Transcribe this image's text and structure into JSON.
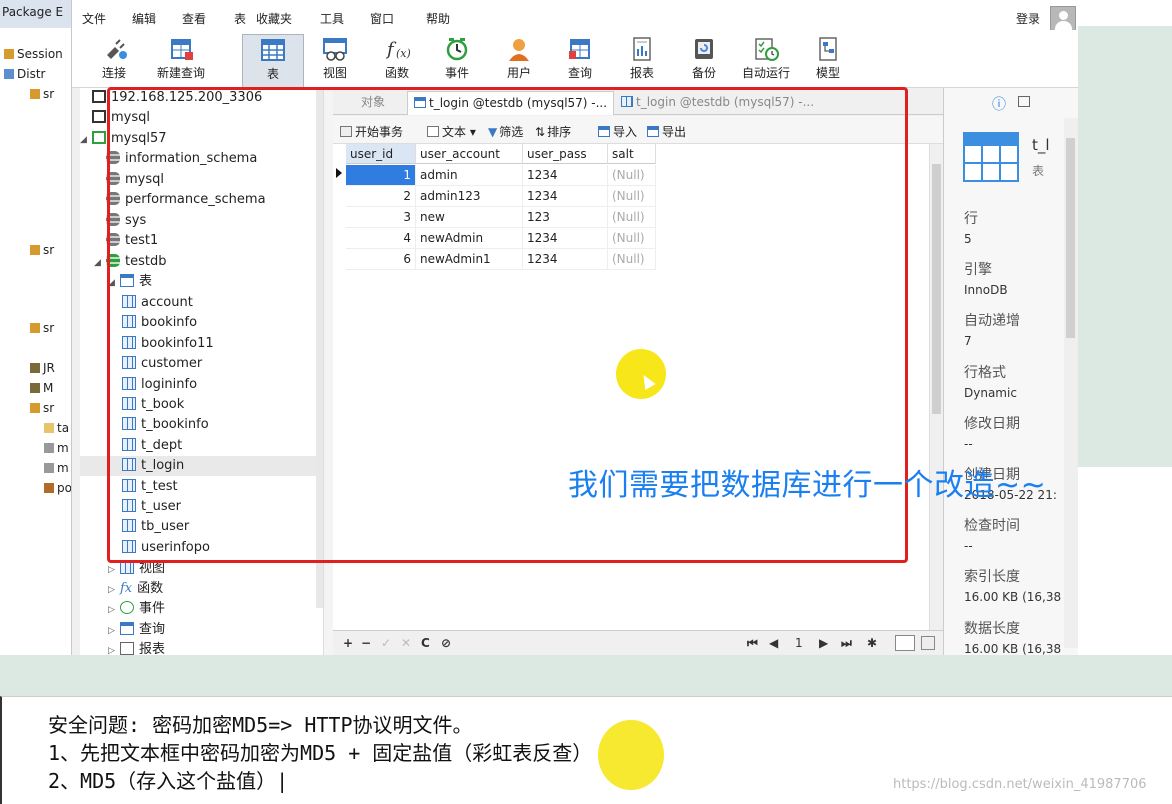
{
  "eclipse": {
    "header": "Package E",
    "items": [
      "Session",
      "Distr",
      "sr",
      "sr",
      "sr",
      "JR",
      "M",
      "sr",
      "ta",
      "m",
      "m",
      "po"
    ]
  },
  "menubar": {
    "items": [
      "文件",
      "编辑",
      "查看",
      "表",
      "收藏夹",
      "工具",
      "窗口",
      "帮助"
    ],
    "login": "登录"
  },
  "toolbar": {
    "buttons": [
      {
        "label": "连接",
        "icon": "plug-icon"
      },
      {
        "label": "新建查询",
        "icon": "new-query-icon"
      },
      {
        "label": "表",
        "icon": "table-icon",
        "active": true
      },
      {
        "label": "视图",
        "icon": "view-icon"
      },
      {
        "label": "函数",
        "icon": "function-icon"
      },
      {
        "label": "事件",
        "icon": "clock-icon"
      },
      {
        "label": "用户",
        "icon": "user-icon"
      },
      {
        "label": "查询",
        "icon": "query-icon"
      },
      {
        "label": "报表",
        "icon": "report-icon"
      },
      {
        "label": "备份",
        "icon": "backup-icon"
      },
      {
        "label": "自动运行",
        "icon": "autorun-icon"
      },
      {
        "label": "模型",
        "icon": "model-icon"
      }
    ]
  },
  "tree": {
    "connection": "192.168.125.200_3306",
    "conn_mysql": "mysql",
    "conn_mysql57": "mysql57",
    "databases": [
      "information_schema",
      "mysql",
      "performance_schema",
      "sys",
      "test1",
      "testdb"
    ],
    "tables_label": "表",
    "tables": [
      "account",
      "bookinfo",
      "bookinfo11",
      "customer",
      "logininfo",
      "t_book",
      "t_bookinfo",
      "t_dept",
      "t_login",
      "t_test",
      "t_user",
      "tb_user",
      "userinfopo"
    ],
    "selected_table": "t_login",
    "views": "视图",
    "functions": "函数",
    "events": "事件",
    "queries": "查询",
    "reports": "报表",
    "fx": "fx"
  },
  "tabs": {
    "objects": "对象",
    "tab1": "t_login @testdb (mysql57) -...",
    "tab2": "t_login @testdb (mysql57) -..."
  },
  "subtoolbar": {
    "begin_tx": "开始事务",
    "text": "文本",
    "filter": "筛选",
    "sort": "排序",
    "import": "导入",
    "export": "导出"
  },
  "grid": {
    "columns": [
      "user_id",
      "user_account",
      "user_pass",
      "salt"
    ],
    "rows": [
      [
        "1",
        "admin",
        "1234",
        "(Null)"
      ],
      [
        "2",
        "admin123",
        "1234",
        "(Null)"
      ],
      [
        "3",
        "new",
        "123",
        "(Null)"
      ],
      [
        "4",
        "newAdmin",
        "1234",
        "(Null)"
      ],
      [
        "6",
        "newAdmin1",
        "1234",
        "(Null)"
      ]
    ]
  },
  "bottombar": {
    "add": "+",
    "remove": "−",
    "apply": "✓",
    "cancel": "✕",
    "refresh": "C",
    "stop": "⊘",
    "first": "⏮",
    "prev": "◀",
    "page": "1",
    "next": "▶",
    "last": "⏭",
    "settings": "✱"
  },
  "info": {
    "title": "t_l",
    "type": "表",
    "fields": [
      {
        "label": "行",
        "value": "5"
      },
      {
        "label": "引擎",
        "value": "InnoDB"
      },
      {
        "label": "自动递增",
        "value": "7"
      },
      {
        "label": "行格式",
        "value": "Dynamic"
      },
      {
        "label": "修改日期",
        "value": "--"
      },
      {
        "label": "创建日期",
        "value": "2018-05-22 21:"
      },
      {
        "label": "检查时间",
        "value": "--"
      },
      {
        "label": "索引长度",
        "value": "16.00 KB (16,38"
      },
      {
        "label": "数据长度",
        "value": "16.00 KB (16,38"
      }
    ]
  },
  "overlay_text": "我们需要把数据库进行一个改造~~",
  "note": {
    "lines": [
      "安全问题:  密码加密MD5=> HTTP协议明文件。",
      "1、先把文本框中密码加密为MD5 + 固定盐值（彩虹表反查）",
      "2、MD5（存入这个盐值）|"
    ]
  },
  "watermark": "https://blog.csdn.net/weixin_41987706",
  "colors": {
    "highlight": "#e0201f",
    "overlay": "#1a7ff0",
    "cursor": "#f6e61a",
    "selection": "#2f7de1"
  }
}
